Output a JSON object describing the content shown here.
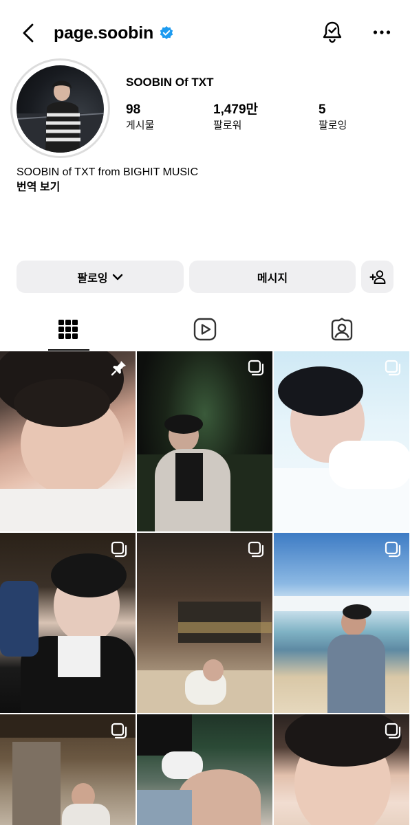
{
  "header": {
    "username": "page.soobin",
    "icons": {
      "back": "chevron-left-icon",
      "verified": "verified-badge-icon",
      "notifications": "bell-check-icon",
      "more": "more-horizontal-icon"
    },
    "colors": {
      "verified": "#1d9bf0"
    }
  },
  "profile": {
    "display_name": "SOOBIN Of TXT",
    "stats": [
      {
        "value": "98",
        "label": "게시물"
      },
      {
        "value": "1,479만",
        "label": "팔로워"
      },
      {
        "value": "5",
        "label": "팔로잉"
      }
    ],
    "bio": "SOOBIN of TXT from BIGHIT MUSIC",
    "translate_label": "번역 보기"
  },
  "actions": {
    "following_label": "팔로잉",
    "message_label": "메시지",
    "add_icon": "add-person-icon"
  },
  "tabs": [
    {
      "name": "grid",
      "icon": "grid-icon",
      "active": true
    },
    {
      "name": "reels",
      "icon": "reels-icon",
      "active": false
    },
    {
      "name": "tagged",
      "icon": "tagged-user-icon",
      "active": false
    }
  ],
  "grid": {
    "posts": [
      {
        "badge": "pin-icon"
      },
      {
        "badge": "multi-post-icon"
      },
      {
        "badge": "multi-post-icon"
      },
      {
        "badge": "multi-post-icon"
      },
      {
        "badge": "multi-post-icon"
      },
      {
        "badge": "multi-post-icon"
      },
      {
        "badge": "multi-post-icon"
      },
      {
        "badge": "none"
      },
      {
        "badge": "multi-post-icon"
      }
    ]
  }
}
